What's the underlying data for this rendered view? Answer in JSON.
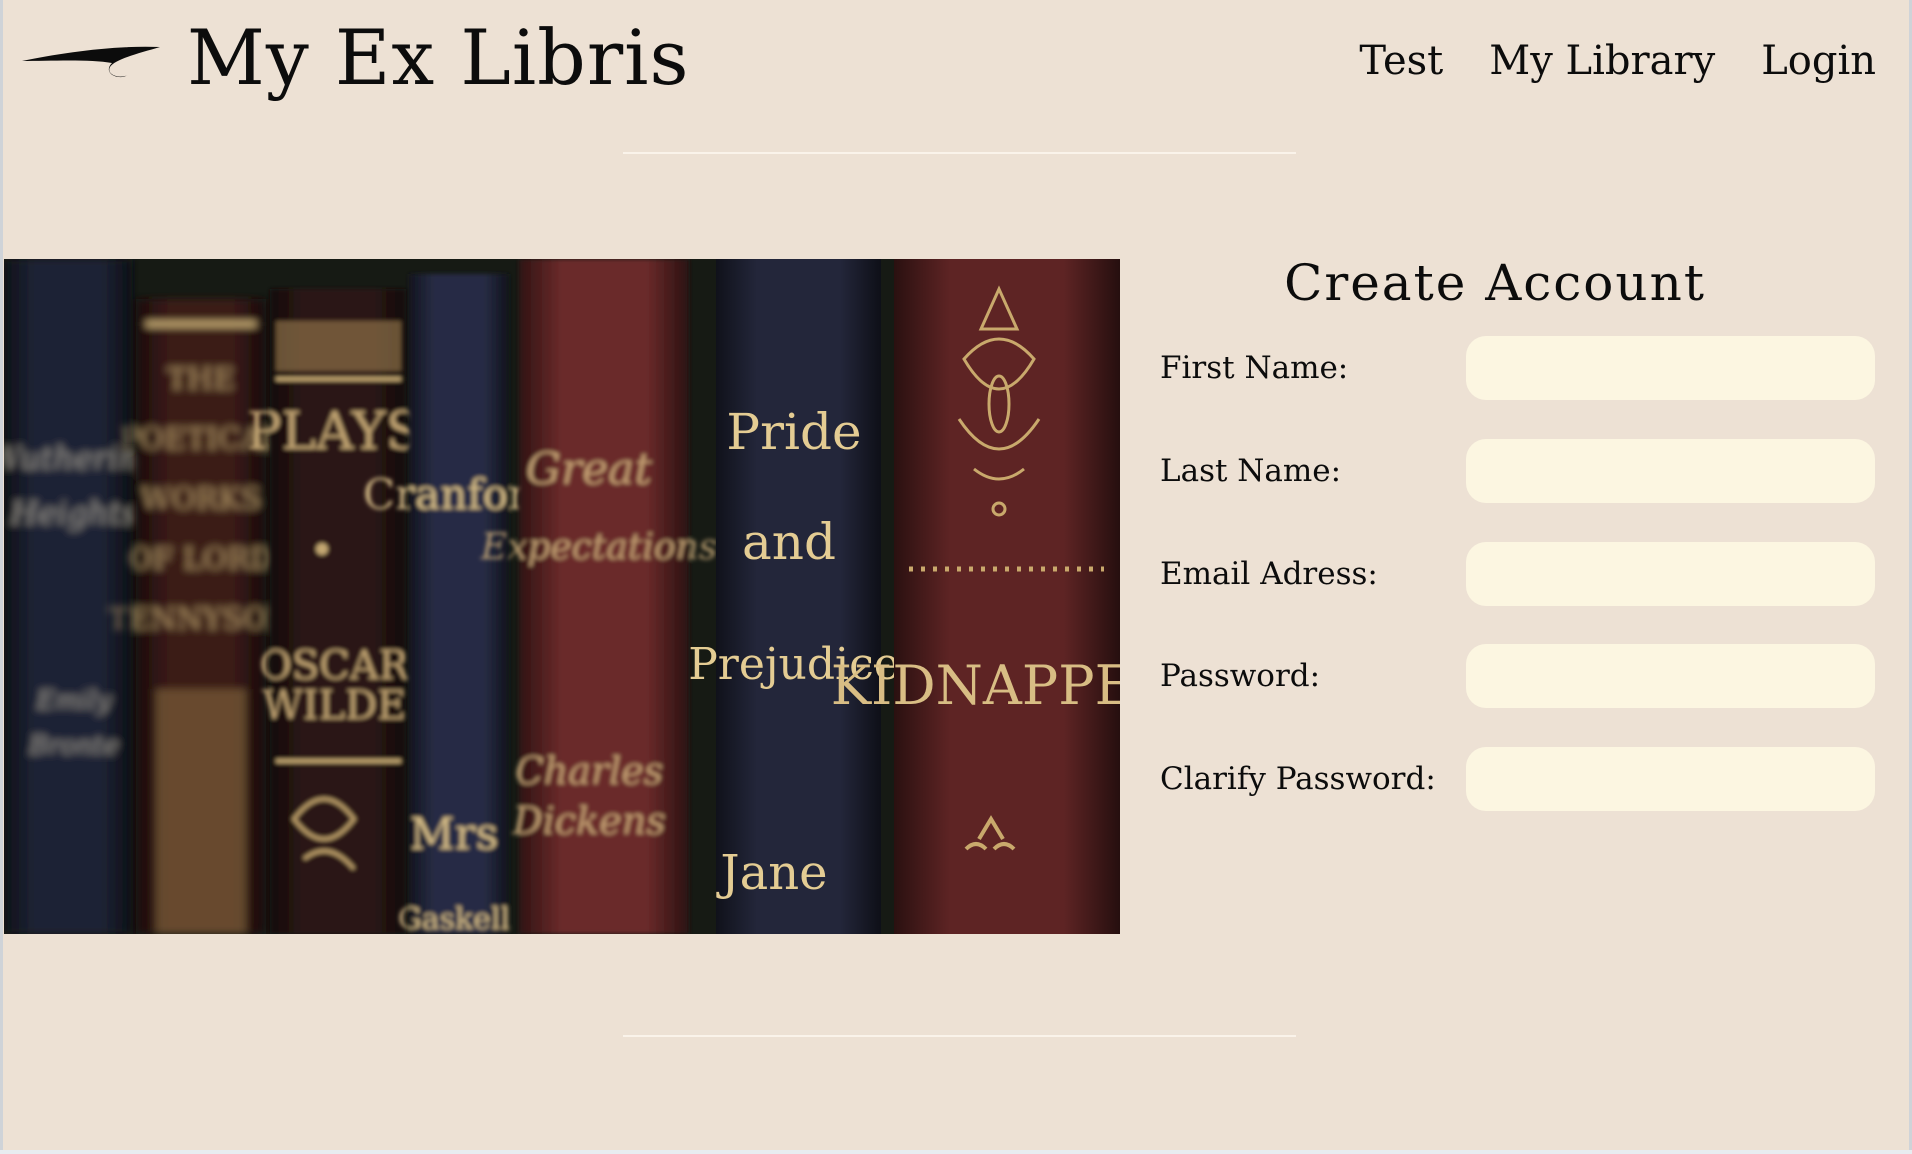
{
  "header": {
    "brand": "My Ex Libris",
    "nav": [
      {
        "label": "Test"
      },
      {
        "label": "My Library"
      },
      {
        "label": "Login"
      }
    ]
  },
  "hero": {
    "spine_texts": {
      "book1": [
        "Wuthering",
        "Heights",
        "Emily",
        "Bronte"
      ],
      "book2": [
        "THE",
        "POETICAL",
        "WORKS",
        "OF LORD",
        "TENNYSON"
      ],
      "book3": [
        "PLAYS",
        "OSCAR",
        "WILDE"
      ],
      "book4": [
        "Cranford",
        "Mrs",
        "Gaskell"
      ],
      "book5": [
        "Great",
        "Expectations",
        "Charles",
        "Dickens"
      ],
      "book6": [
        "Pride",
        "and",
        "Prejudice",
        "Jane"
      ],
      "book7": [
        "KIDNAPPED"
      ]
    }
  },
  "form": {
    "title": "Create Account",
    "fields": [
      {
        "label": "First Name:",
        "value": "",
        "placeholder": ""
      },
      {
        "label": "Last Name:",
        "value": "",
        "placeholder": ""
      },
      {
        "label": "Email Adress:",
        "value": "",
        "placeholder": ""
      },
      {
        "label": "Password:",
        "value": "",
        "placeholder": ""
      },
      {
        "label": "Clarify Password:",
        "value": "",
        "placeholder": ""
      }
    ]
  },
  "colors": {
    "background": "#ede1d4",
    "input_fill": "#fcf6e1",
    "text": "#0c0c0c",
    "divider": "#faf3ea"
  }
}
